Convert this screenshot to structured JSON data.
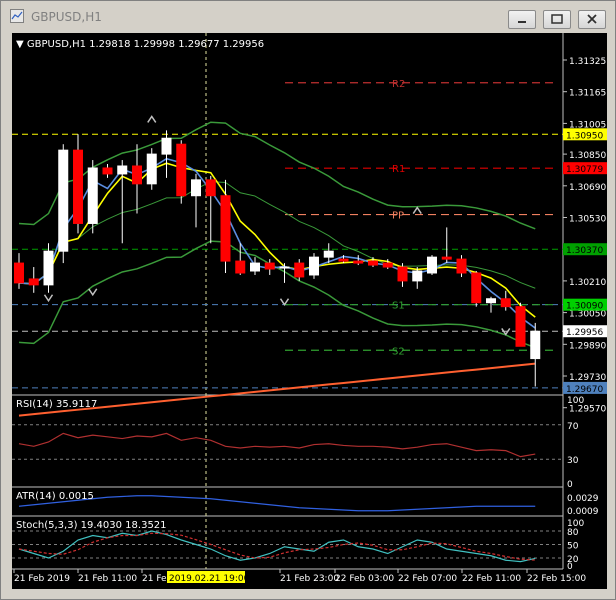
{
  "window": {
    "title": "GBPUSD,H1"
  },
  "header": {
    "text": "GBPUSD,H1  1.29818 1.29998 1.29677 1.29956"
  },
  "chart_data": {
    "type": "candlestick",
    "symbol": "GBPUSD",
    "timeframe": "H1",
    "ohlc_header": [
      1.29818,
      1.29998,
      1.29677,
      1.29956
    ],
    "price_ticks": [
      "1.31325",
      "1.31165",
      "1.31005",
      "1.30850",
      "1.30690",
      "1.30530",
      "1.30370",
      "1.30210",
      "1.30050",
      "1.29890",
      "1.29730",
      "1.29570"
    ],
    "price_range": [
      1.2955,
      1.3145
    ],
    "x_ticks": [
      "21 Feb 2019",
      "21 Feb 11:00",
      "21 Feb",
      "2019.02.21 19:00",
      "21 Feb 23:00",
      "22 Feb 03:00",
      "22 Feb 07:00",
      "22 Feb 11:00",
      "22 Feb 15:00"
    ],
    "pivots": [
      {
        "name": "R2",
        "value": 1.3121,
        "color": "#c03030"
      },
      {
        "name": "R1",
        "value": 1.30779,
        "color": "#e00000"
      },
      {
        "name": "PP",
        "value": 1.30545,
        "color": "#f08060"
      },
      {
        "name": "S1",
        "value": 1.3009,
        "color": "#30a030"
      },
      {
        "name": "S2",
        "value": 1.2986,
        "color": "#30a030"
      }
    ],
    "price_labels": [
      {
        "text": "1.30950",
        "bg": "#ffff00",
        "fg": "#000000"
      },
      {
        "text": "1.30779",
        "bg": "#ff0000",
        "fg": "#000000"
      },
      {
        "text": "1.30370",
        "bg": "#00a000",
        "fg": "#000000"
      },
      {
        "text": "1.30090",
        "bg": "#00d000",
        "fg": "#000000"
      },
      {
        "text": "1.29956",
        "bg": "#ffffff",
        "fg": "#000000"
      },
      {
        "text": "1.29670",
        "bg": "#4f81bd",
        "fg": "#000000"
      }
    ],
    "hlines": [
      {
        "value": 1.3095,
        "color": "#ffff00"
      },
      {
        "value": 1.3037,
        "color": "#00a000"
      },
      {
        "value": 1.3009,
        "color": "#4f81bd"
      },
      {
        "value": 1.29956,
        "color": "#c0c0c0"
      },
      {
        "value": 1.2967,
        "color": "#4f81bd"
      }
    ],
    "candles": [
      [
        1.303,
        1.3035,
        1.3017,
        1.302
      ],
      [
        1.3022,
        1.3028,
        1.3015,
        1.3019
      ],
      [
        1.3019,
        1.304,
        1.3015,
        1.3036
      ],
      [
        1.3036,
        1.309,
        1.303,
        1.3087
      ],
      [
        1.3087,
        1.3095,
        1.3045,
        1.305
      ],
      [
        1.305,
        1.3082,
        1.3045,
        1.3078
      ],
      [
        1.3078,
        1.308,
        1.3073,
        1.3075
      ],
      [
        1.3075,
        1.3082,
        1.304,
        1.3079
      ],
      [
        1.3079,
        1.309,
        1.3055,
        1.307
      ],
      [
        1.307,
        1.3088,
        1.3067,
        1.3085
      ],
      [
        1.3085,
        1.3097,
        1.3073,
        1.3093
      ],
      [
        1.309,
        1.3092,
        1.306,
        1.3064
      ],
      [
        1.3064,
        1.3075,
        1.3048,
        1.3072
      ],
      [
        1.3072,
        1.3074,
        1.304,
        1.3064
      ],
      [
        1.3064,
        1.3072,
        1.3025,
        1.3031
      ],
      [
        1.3031,
        1.304,
        1.3024,
        1.3025
      ],
      [
        1.3026,
        1.3033,
        1.3024,
        1.303
      ],
      [
        1.303,
        1.3032,
        1.3024,
        1.3027
      ],
      [
        1.3028,
        1.303,
        1.302,
        1.3028
      ],
      [
        1.303,
        1.3032,
        1.3021,
        1.3023
      ],
      [
        1.3024,
        1.3035,
        1.3022,
        1.3033
      ],
      [
        1.3033,
        1.304,
        1.303,
        1.3036
      ],
      [
        1.3032,
        1.3034,
        1.303,
        1.3031
      ],
      [
        1.3031,
        1.3034,
        1.3029,
        1.303
      ],
      [
        1.3031,
        1.3033,
        1.3028,
        1.3029
      ],
      [
        1.303,
        1.3032,
        1.3027,
        1.3028
      ],
      [
        1.3028,
        1.303,
        1.3018,
        1.3021
      ],
      [
        1.3021,
        1.3028,
        1.3017,
        1.3026
      ],
      [
        1.3025,
        1.3034,
        1.3024,
        1.3033
      ],
      [
        1.3033,
        1.3048,
        1.303,
        1.3032
      ],
      [
        1.3032,
        1.3034,
        1.3023,
        1.3025
      ],
      [
        1.3025,
        1.3026,
        1.3008,
        1.301
      ],
      [
        1.301,
        1.3013,
        1.3005,
        1.3012
      ],
      [
        1.3012,
        1.3016,
        1.3006,
        1.3008
      ],
      [
        1.3008,
        1.301,
        1.2988,
        1.2988
      ],
      [
        1.29818,
        1.29998,
        1.29677,
        1.29956
      ]
    ],
    "indicators": {
      "rsi": {
        "label": "RSI(14) 35.9117",
        "levels": [
          "100",
          "70",
          "30",
          "0"
        ]
      },
      "atr": {
        "label": "ATR(14) 0.0015",
        "levels": [
          "0.0029",
          "0.0009"
        ]
      },
      "stoch": {
        "label": "Stoch(5,3,3) 19.4030 18.3521",
        "levels": [
          "100",
          "80",
          "50",
          "20",
          "0"
        ]
      }
    }
  }
}
